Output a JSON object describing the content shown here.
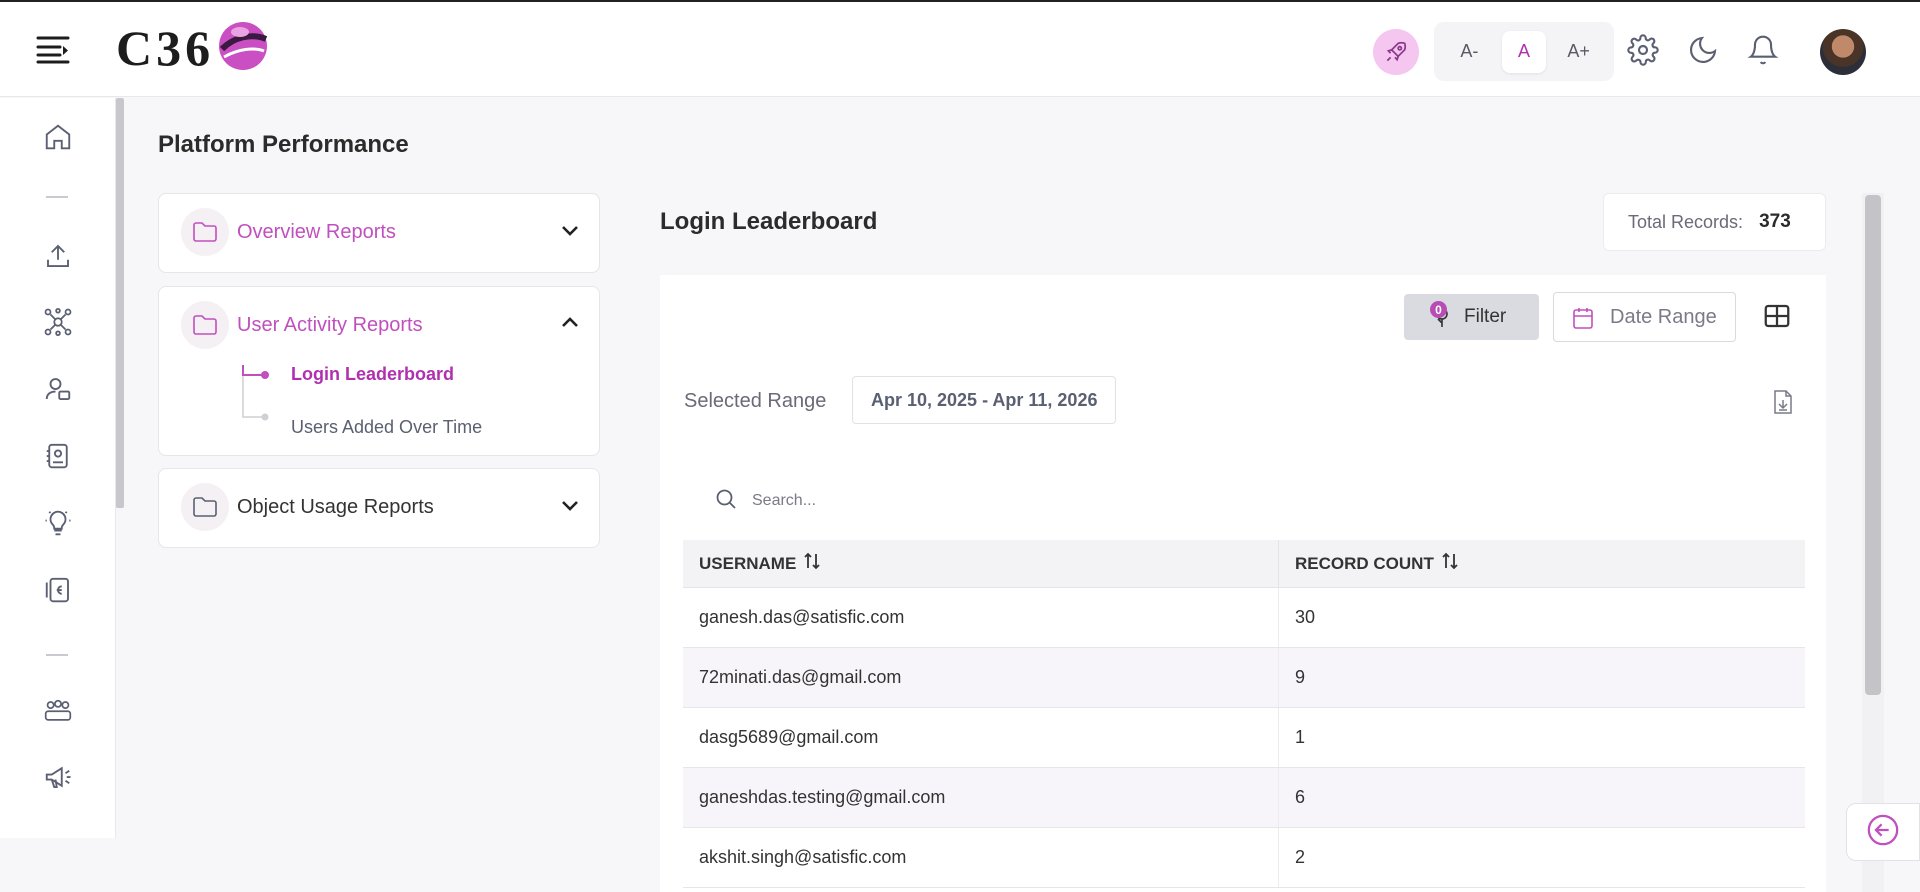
{
  "header": {
    "logo_text": "C36",
    "font_controls": [
      "A-",
      "A",
      "A+"
    ]
  },
  "page": {
    "title": "Platform Performance"
  },
  "reports_nav": {
    "overview": {
      "label": "Overview Reports"
    },
    "user_activity": {
      "label": "User Activity Reports",
      "items": [
        {
          "label": "Login Leaderboard",
          "active": true
        },
        {
          "label": "Users Added Over Time",
          "active": false
        }
      ]
    },
    "object_usage": {
      "label": "Object Usage Reports"
    }
  },
  "main": {
    "title": "Login Leaderboard",
    "total_label": "Total Records:",
    "total_value": "373",
    "filter_label": "Filter",
    "filter_count": "0",
    "date_range_label": "Date Range",
    "selected_range_label": "Selected Range",
    "selected_range_value": "Apr 10, 2025 - Apr 11, 2026",
    "search_placeholder": "Search...",
    "columns": [
      "USERNAME",
      "RECORD COUNT"
    ],
    "rows": [
      {
        "username": "ganesh.das@satisfic.com",
        "count": "30"
      },
      {
        "username": "72minati.das@gmail.com",
        "count": "9"
      },
      {
        "username": "dasg5689@gmail.com",
        "count": "1"
      },
      {
        "username": "ganeshdas.testing@gmail.com",
        "count": "6"
      },
      {
        "username": "akshit.singh@satisfic.com",
        "count": "2"
      }
    ]
  },
  "colors": {
    "accent": "#b64cb4",
    "active_text": "#b030b0"
  }
}
